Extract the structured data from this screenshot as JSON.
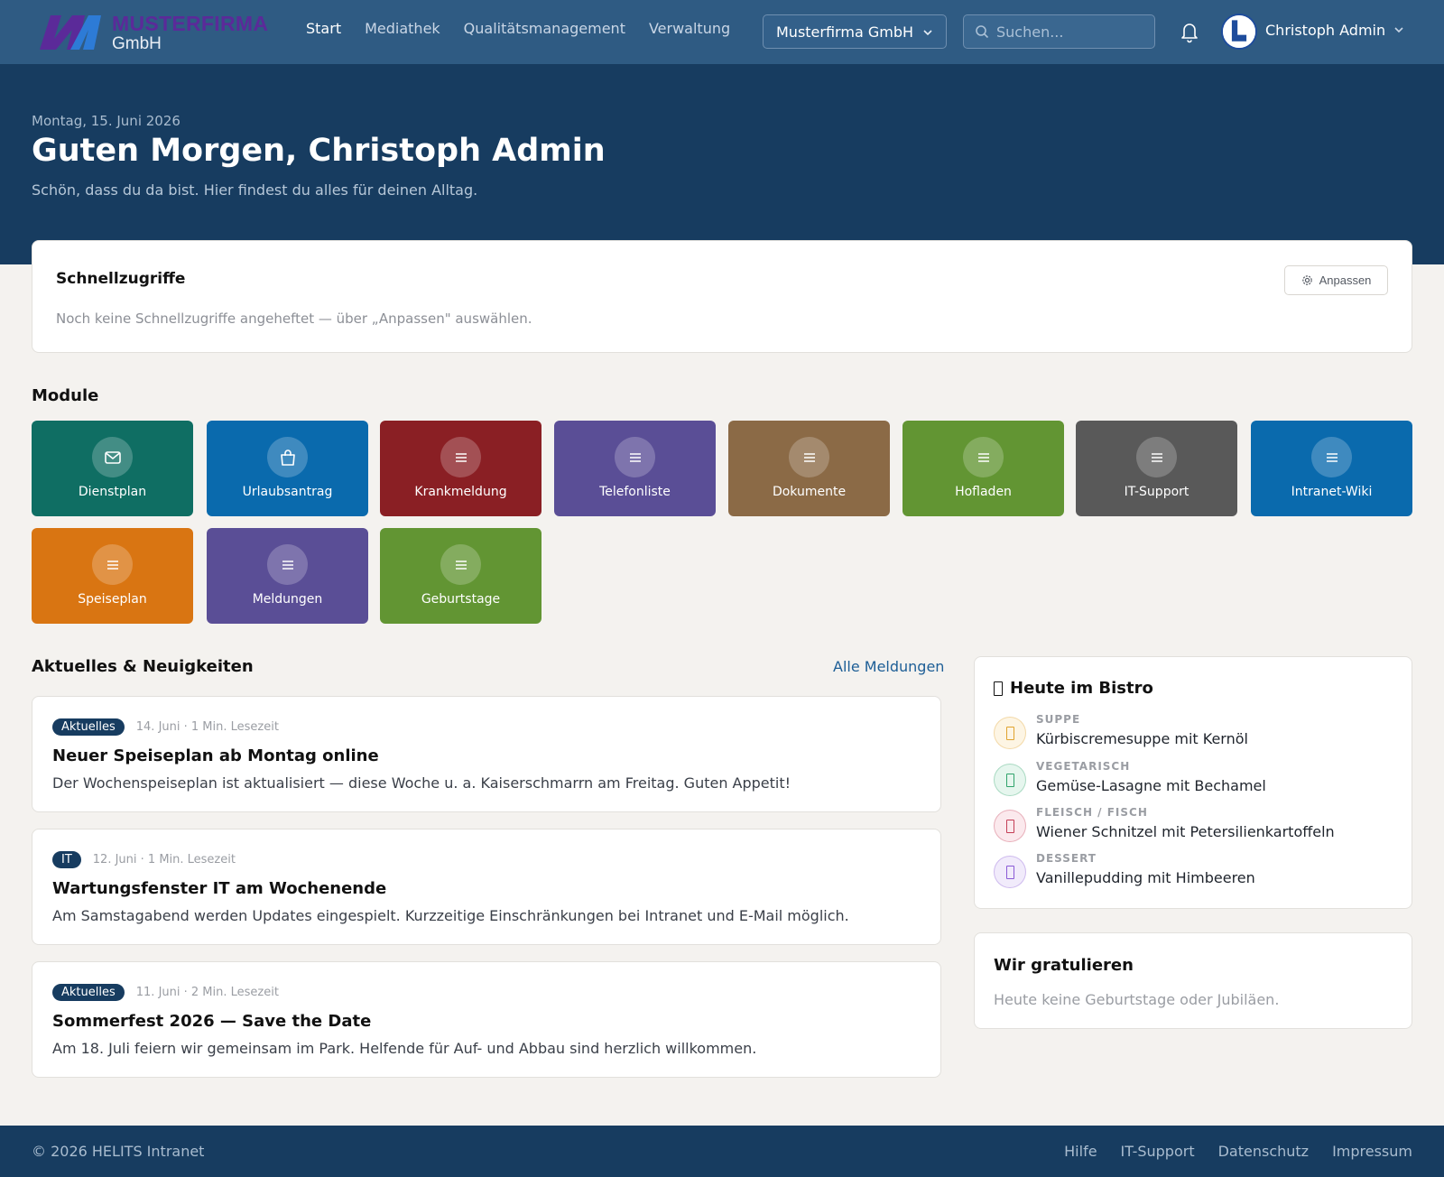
{
  "logo": {
    "line1": "MUSTERFIRMA",
    "line2": "GmbH"
  },
  "nav": [
    {
      "label": "Start",
      "active": true
    },
    {
      "label": "Mediathek",
      "active": false
    },
    {
      "label": "Qualitätsmanagement",
      "active": false
    },
    {
      "label": "Verwaltung",
      "active": false
    }
  ],
  "company_select": {
    "value": "Musterfirma GmbH",
    "icon": "chevron-down-icon"
  },
  "search": {
    "placeholder": "Suchen...",
    "icon": "search-icon"
  },
  "notifications": {
    "icon": "bell-icon"
  },
  "user": {
    "name": "Christoph Admin",
    "icon": "chevron-down-icon"
  },
  "hero": {
    "date": "Montag, 15. Juni 2026",
    "greeting": "Guten Morgen, Christoph Admin",
    "subtitle": "Schön, dass du da bist. Hier findest du alles für deinen Alltag."
  },
  "quick_access": {
    "title": "Schnellzugriffe",
    "empty_text": "Noch keine Schnellzugriffe angeheftet — über „Anpassen\" auswählen.",
    "adjust_label": "Anpassen",
    "adjust_icon": "gear-icon"
  },
  "modules": {
    "heading": "Module",
    "items": [
      {
        "label": "Dienstplan",
        "color": "#0f6e63",
        "icon": "mail-icon"
      },
      {
        "label": "Urlaubsantrag",
        "color": "#0a6aad",
        "icon": "bag-icon"
      },
      {
        "label": "Krankmeldung",
        "color": "#8a1f24",
        "icon": "menu-icon"
      },
      {
        "label": "Telefonliste",
        "color": "#5a4e96",
        "icon": "menu-icon"
      },
      {
        "label": "Dokumente",
        "color": "#8b6a46",
        "icon": "menu-icon"
      },
      {
        "label": "Hofladen",
        "color": "#629533",
        "icon": "menu-icon"
      },
      {
        "label": "IT-Support",
        "color": "#595959",
        "icon": "menu-icon"
      },
      {
        "label": "Intranet-Wiki",
        "color": "#0a6aad",
        "icon": "menu-icon"
      },
      {
        "label": "Speiseplan",
        "color": "#d97512",
        "icon": "menu-icon"
      },
      {
        "label": "Meldungen",
        "color": "#5a4e96",
        "icon": "menu-icon"
      },
      {
        "label": "Geburtstage",
        "color": "#629533",
        "icon": "menu-icon"
      }
    ]
  },
  "news": {
    "heading": "Aktuelles & Neuigkeiten",
    "all_link": "Alle Meldungen",
    "items": [
      {
        "badge": "Aktuelles",
        "meta": "14. Juni · 1 Min. Lesezeit",
        "title": "Neuer Speiseplan ab Montag online",
        "body": "Der Wochenspeiseplan ist aktualisiert — diese Woche u. a. Kaiserschmarrn am Freitag. Guten Appetit!"
      },
      {
        "badge": "IT",
        "meta": "12. Juni · 1 Min. Lesezeit",
        "title": "Wartungsfenster IT am Wochenende",
        "body": "Am Samstagabend werden Updates eingespielt. Kurzzeitige Einschränkungen bei Intranet und E-Mail möglich."
      },
      {
        "badge": "Aktuelles",
        "meta": "11. Juni · 2 Min. Lesezeit",
        "title": "Sommerfest 2026 — Save the Date",
        "body": "Am 18. Juli feiern wir gemeinsam im Park. Helfende für Auf- und Abbau sind herzlich willkommen."
      }
    ]
  },
  "bistro": {
    "title": "Heute im Bistro",
    "dishes": [
      {
        "category": "SUPPE",
        "name": "Kürbiscremesuppe mit Kernöl",
        "color": "#e0a32e",
        "bg": "#fdf5e4"
      },
      {
        "category": "VEGETARISCH",
        "name": "Gemüse-Lasagne mit Bechamel",
        "color": "#2fa36b",
        "bg": "#e6f6ee"
      },
      {
        "category": "FLEISCH / FISCH",
        "name": "Wiener Schnitzel mit Petersilienkartoffeln",
        "color": "#c43d55",
        "bg": "#fbe9ed"
      },
      {
        "category": "DESSERT",
        "name": "Vanillepudding mit Himbeeren",
        "color": "#8a5ad6",
        "bg": "#f1ebfb"
      }
    ]
  },
  "congrats": {
    "title": "Wir gratulieren",
    "empty_text": "Heute keine Geburtstage oder Jubiläen."
  },
  "footer": {
    "copyright": "© 2026 HELITS Intranet",
    "links": [
      "Hilfe",
      "IT-Support",
      "Datenschutz",
      "Impressum"
    ]
  }
}
